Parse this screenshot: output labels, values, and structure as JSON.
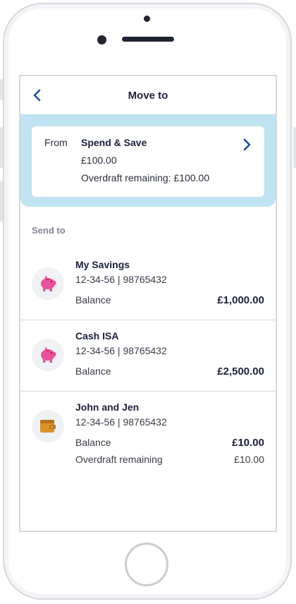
{
  "header": {
    "title": "Move to"
  },
  "from": {
    "label": "From",
    "account_name": "Spend & Save",
    "amount": "£100.00",
    "overdraft": "Overdraft remaining: £100.00"
  },
  "send_to": {
    "heading": "Send to",
    "accounts": [
      {
        "name": "My Savings",
        "number": "12-34-56 | 98765432",
        "balance_label": "Balance",
        "balance": "£1,000.00",
        "icon": "piggy-bank-icon"
      },
      {
        "name": "Cash ISA",
        "number": "12-34-56 | 98765432",
        "balance_label": "Balance",
        "balance": "£2,500.00",
        "icon": "piggy-bank-icon"
      },
      {
        "name": "John and Jen",
        "number": "12-34-56 | 98765432",
        "balance_label": "Balance",
        "balance": "£10.00",
        "overdraft_label": "Overdraft remaining",
        "overdraft": "£10.00",
        "icon": "wallet-icon"
      }
    ]
  },
  "colors": {
    "accent": "#1d4fa0",
    "panel": "#bfe3f1",
    "piggy": "#e9519a",
    "wallet": "#d9932a"
  }
}
